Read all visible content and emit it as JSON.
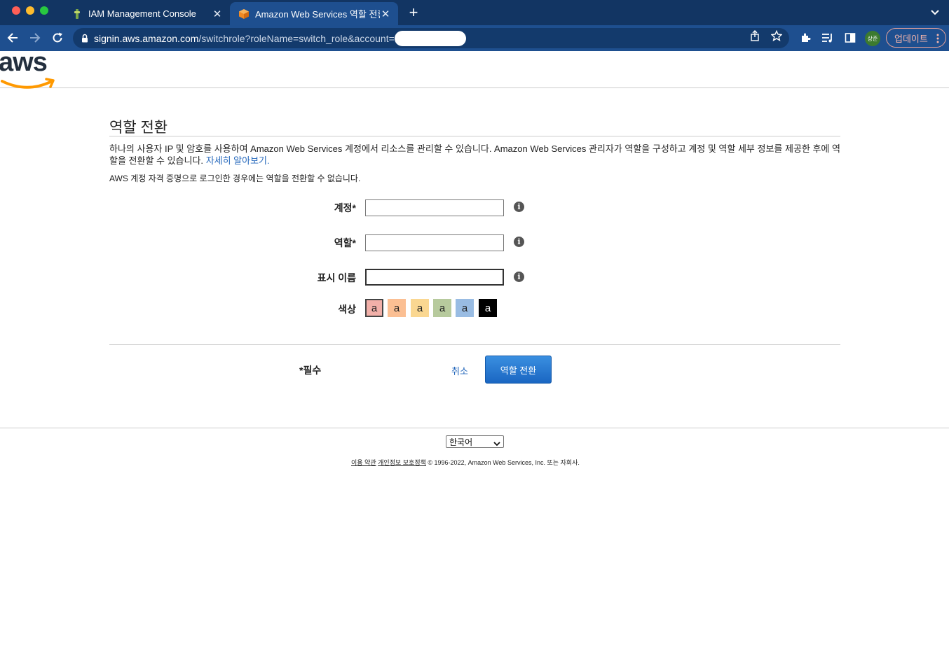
{
  "browser": {
    "tabs": [
      {
        "title": "IAM Management Console",
        "active": false
      },
      {
        "title": "Amazon Web Services 역할 전환",
        "active": true
      }
    ],
    "address": {
      "host": "signin.aws.amazon.com",
      "path": "/switchrole?roleName=switch_role&account="
    },
    "profile_initials": "상준",
    "update_label": "업데이트"
  },
  "page": {
    "title": "역할 전환",
    "description": "하나의 사용자 IP 및 암호를 사용하여 Amazon Web Services 계정에서 리소스를 관리할 수 있습니다. Amazon Web Services 관리자가 역할을 구성하고 계정 및 역할 세부 정보를 제공한 후에 역할을 전환할 수 있습니다.",
    "learn_more": "자세히 알아보기.",
    "note": "AWS 계정 자격 증명으로 로그인한 경우에는 역할을 전환할 수 없습니다."
  },
  "form": {
    "account_label": "계정*",
    "role_label": "역할*",
    "display_name_label": "표시 이름",
    "color_label": "색상",
    "account_value": "",
    "role_value": "",
    "display_name_value": "",
    "info_glyph": "i",
    "swatches": [
      {
        "letter": "a",
        "color": "#f2b0a9",
        "selected": true
      },
      {
        "letter": "a",
        "color": "#fbbf93",
        "selected": false
      },
      {
        "letter": "a",
        "color": "#fad791",
        "selected": false
      },
      {
        "letter": "a",
        "color": "#b7ca9d",
        "selected": false
      },
      {
        "letter": "a",
        "color": "#99bce3",
        "selected": false
      },
      {
        "letter": "a",
        "color": "#000000",
        "selected": false
      }
    ],
    "required_note": "*필수",
    "cancel_label": "취소",
    "submit_label": "역할 전환"
  },
  "footer": {
    "language": "한국어",
    "terms": "이용 약관",
    "privacy": "개인정보 보호정책",
    "copyright": "© 1996-2022, Amazon Web Services, Inc. 또는 자회사."
  },
  "colors": {
    "tabbar": "#123563",
    "toolbar": "#1e4f8f",
    "link": "#2266bb",
    "primary": "#1a66c2",
    "aws_orange": "#ff9900",
    "aws_text": "#232f3e"
  },
  "icons": [
    "back-icon",
    "forward-icon",
    "reload-icon",
    "lock-icon",
    "share-icon",
    "star-icon",
    "extensions-icon",
    "reading-list-icon",
    "side-panel-icon",
    "info-icon",
    "chevron-down-icon"
  ]
}
